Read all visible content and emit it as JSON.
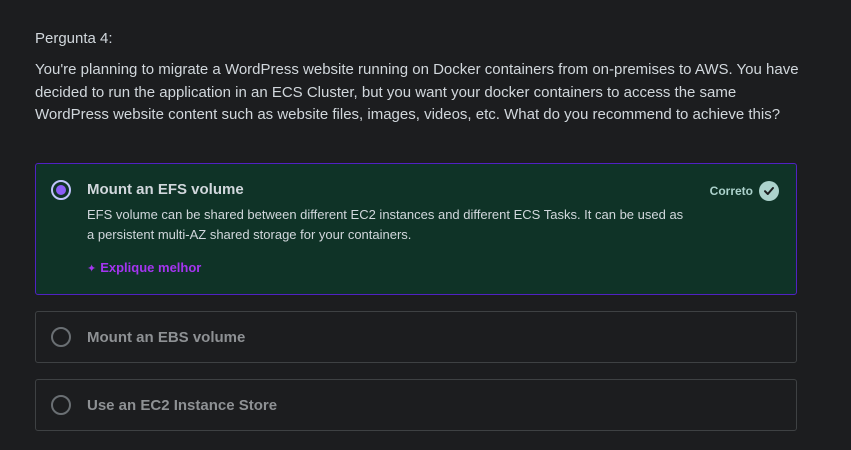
{
  "question": {
    "number_label": "Pergunta 4:",
    "text": "You're planning to migrate a WordPress website running on Docker containers from on-premises to AWS. You have decided to run the application in an ECS Cluster, but you want your docker containers to access the same WordPress website content such as website files, images, videos, etc. What do you recommend to achieve this?"
  },
  "options": [
    {
      "label": "Mount an EFS volume",
      "selected": true,
      "result_label": "Correto",
      "explanation": "EFS volume can be shared between different EC2 instances and different ECS Tasks. It can be used as a persistent multi-AZ shared storage for your containers.",
      "explain_more_label": "Explique melhor"
    },
    {
      "label": "Mount an EBS volume",
      "selected": false
    },
    {
      "label": "Use an EC2 Instance Store",
      "selected": false
    }
  ],
  "colors": {
    "background": "#1c1d1f",
    "correct_bg": "#0f3327",
    "selected_border": "#5022c3",
    "accent_purple": "#a435f0",
    "correct_green": "#acd2cc"
  },
  "icons": {
    "radio_selected": "radio-selected-icon",
    "radio_unselected": "radio-unselected-icon",
    "check": "check-circle-icon",
    "sparkle": "sparkle-icon"
  }
}
